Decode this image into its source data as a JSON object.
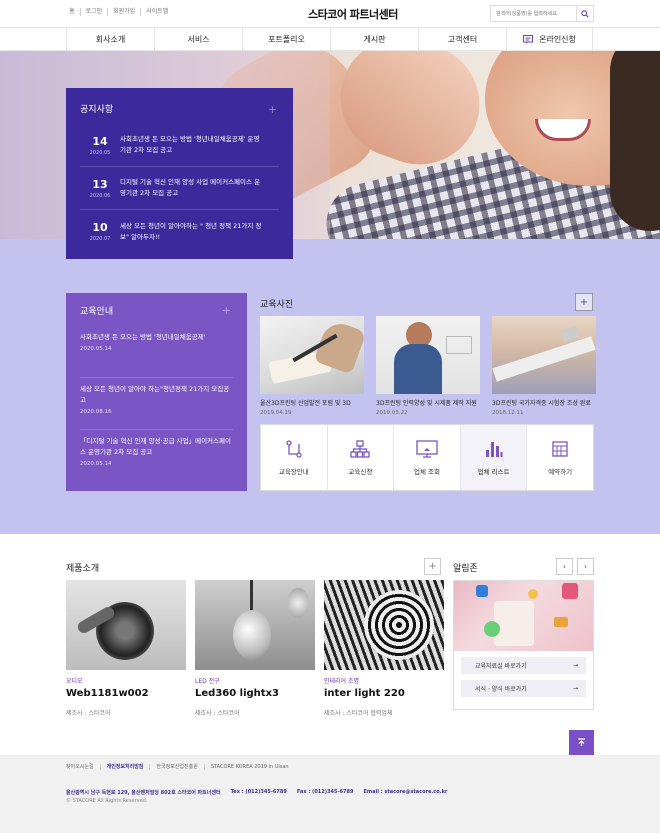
{
  "util": {
    "items": [
      "홈",
      "로그인",
      "회원가입",
      "사이트맵"
    ]
  },
  "logo": "스타코어 파트너센터",
  "search": {
    "placeholder": "검색어(상품명)를 입력하세요.",
    "icon": "search-icon"
  },
  "gnb": {
    "items": [
      "회사소개",
      "서비스",
      "포트폴리오",
      "게시판",
      "고객센터",
      "온라인신청"
    ]
  },
  "notice": {
    "title": "공지사항",
    "items": [
      {
        "day": "14",
        "ym": "2020.05",
        "text": "사회초년생 돈 모으는 방법 '청년내일채움공제' 운영기관 2차 모집 공고"
      },
      {
        "day": "13",
        "ym": "2020.06",
        "text": "디지털 기술 혁신 인재 양성 사업 메이커스페이스 운영기관 2차 모집 공고"
      },
      {
        "day": "10",
        "ym": "2020.07",
        "text": "세상 모든 청년이 알아야하는 \" 청년 정책 21가지 정보\" 알아두자!!"
      }
    ]
  },
  "edu": {
    "title": "교육안내",
    "items": [
      {
        "text": "사회초년생 돈 모으는 방법 '청년내일채움공제'",
        "date": "2020.05.14"
      },
      {
        "text": "세상 모든 청년이 알아야 하는\"청년정책 21가지 모집공고",
        "date": "2020.08.16"
      },
      {
        "text": "「디지털 기술 혁신 인재 양성·공급 사업」메이커스페이스 운영기관 2차 모집 공고",
        "date": "2020.05.14"
      }
    ]
  },
  "photos": {
    "title": "교육사진",
    "items": [
      {
        "caption": "울산3D프린팅 산업발전 포럼 및 3D",
        "date": "2019.04.19"
      },
      {
        "caption": "3D프린팅 인력양성 및 시제품 제작 지원",
        "date": "2019.03.22"
      },
      {
        "caption": "3D프린팅 국가자격증 시험장 조성 완료",
        "date": "2018.12.11"
      }
    ]
  },
  "quick": {
    "items": [
      {
        "label": "교육장안내",
        "icon": "route-icon"
      },
      {
        "label": "교육신청",
        "icon": "sitemap-icon"
      },
      {
        "label": "업체 조회",
        "icon": "monitor-icon"
      },
      {
        "label": "업체 리스트",
        "icon": "bar-chart-icon"
      },
      {
        "label": "예약하기",
        "icon": "calendar-icon"
      }
    ]
  },
  "products": {
    "title": "제품소개",
    "items": [
      {
        "cat": "오디오",
        "name": "Web1181w002",
        "maker": "제조사 : 스타코어"
      },
      {
        "cat": "LED 전구",
        "name": "Led360 lightx3",
        "maker": "제조사 : 스타코어"
      },
      {
        "cat": "인테리어 조명",
        "name": "inter light 220",
        "maker": "제조사 : 스타코어 협력업체"
      }
    ]
  },
  "alarm": {
    "title": "알림존",
    "links": [
      "교육자료실 바로가기",
      "서식 · 양식 바로가기"
    ]
  },
  "footer": {
    "nav": [
      "찾아오시는길",
      "개인정보처리방침",
      "한국정보산업진흥원",
      "STACORE KOREA 2019 in Ulsan"
    ],
    "address": "울산광역시 남구 득현로 129, 울산벤처빌딩 802호  스타코어 파트너센터",
    "tel": "Tex : (012)345-6789",
    "fax": "Fax : (012)345-6789",
    "email": "Email : stacore@stacore.co.kr",
    "copy": "© STACORE All Rights Reserved."
  },
  "colors": {
    "primary": "#3c2a9d",
    "edu": "#7b55c4",
    "band": "#c4c3ef",
    "accent": "#6b2fc0"
  }
}
